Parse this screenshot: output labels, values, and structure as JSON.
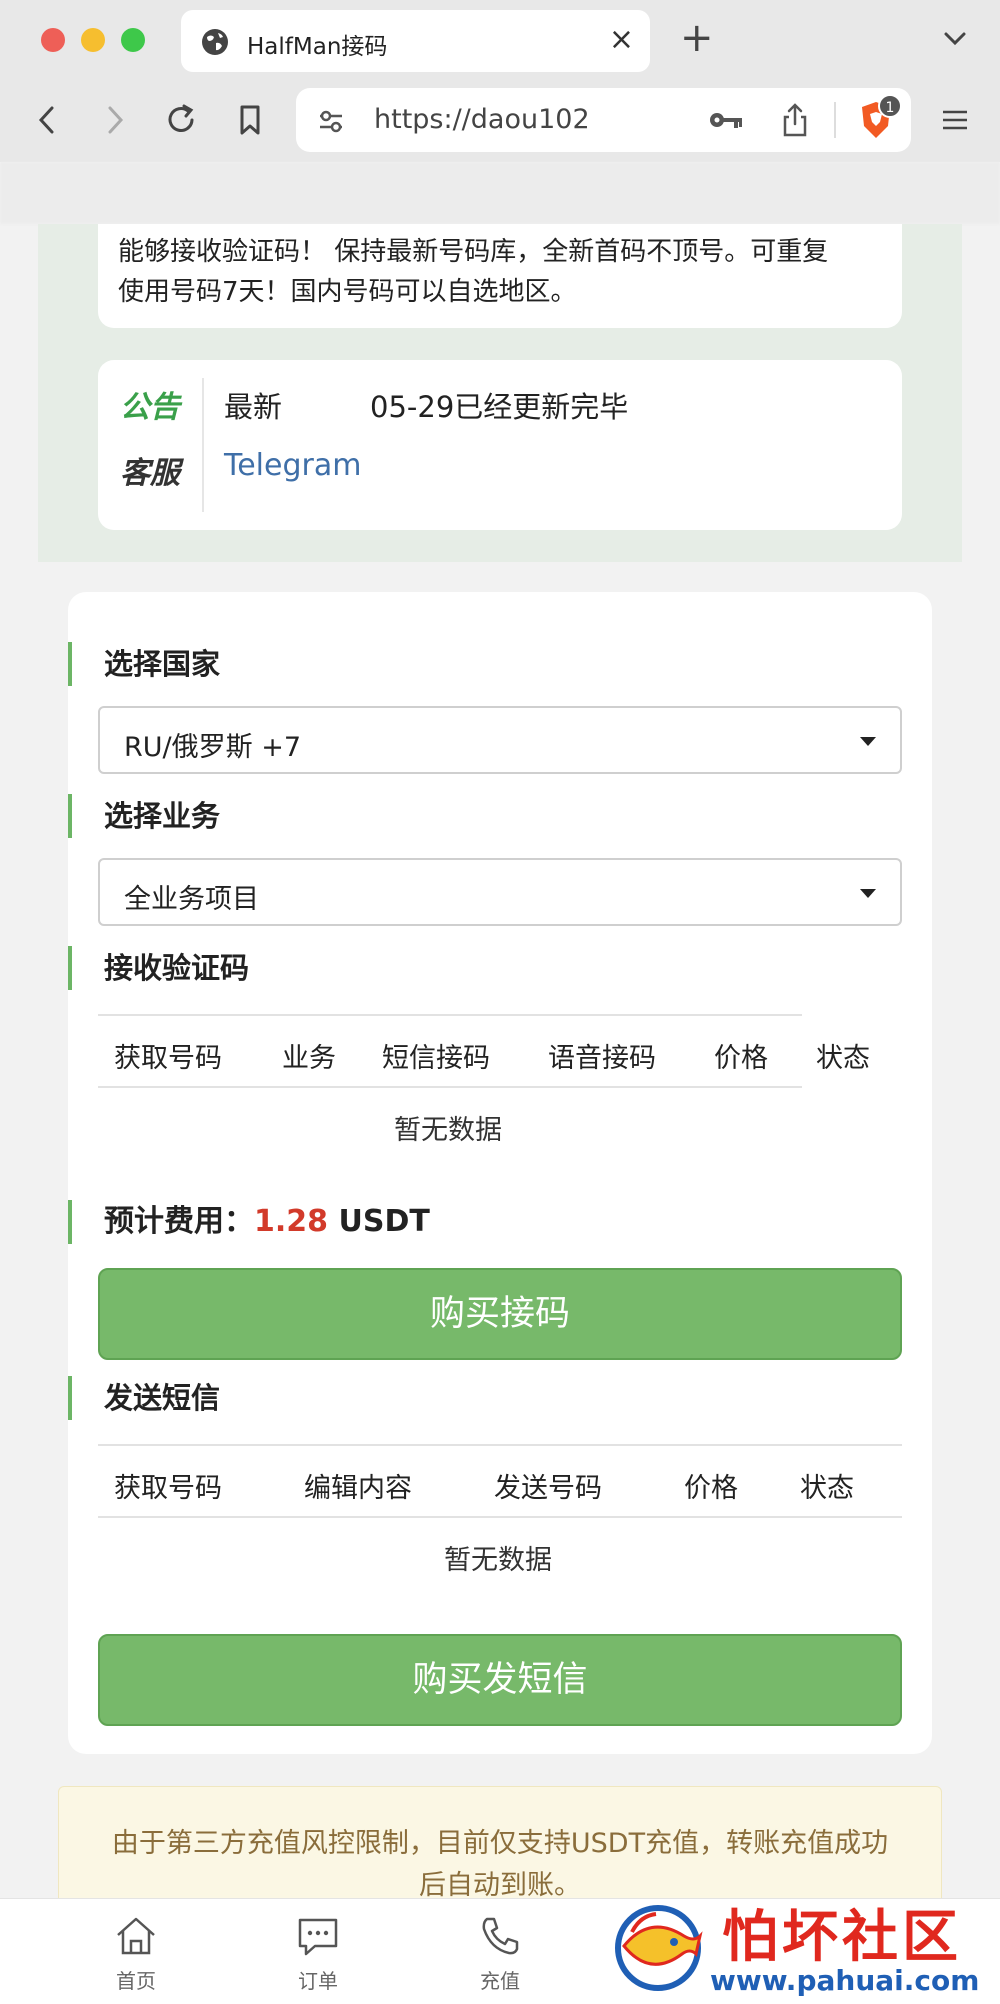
{
  "browser": {
    "tab_title": "HalfMan接码",
    "new_tab": "+",
    "tab_close": "×",
    "url": "https://daou102",
    "brave_badge": "1"
  },
  "intro": {
    "line1": "能够接收验证码！ 保持最新号码库，全新首码不顶号。可重复",
    "line2": "使用号码7天！国内号码可以自选地区。"
  },
  "notice": {
    "key1": "公告",
    "key2": "客服",
    "label": "最新",
    "text": "05-29已经更新完毕",
    "link": "Telegram"
  },
  "country": {
    "title": "选择国家",
    "value": "RU/俄罗斯 +7"
  },
  "service": {
    "title": "选择业务",
    "value": "全业务项目"
  },
  "receive": {
    "title": "接收验证码",
    "headers": [
      "获取号码",
      "业务",
      "短信接码",
      "语音接码",
      "价格",
      "状态"
    ],
    "empty": "暂无数据"
  },
  "cost": {
    "label": "预计费用：",
    "value": "1.28",
    "unit": " USDT"
  },
  "buy_receive_label": "购买接码",
  "send": {
    "title": "发送短信",
    "headers": [
      "获取号码",
      "编辑内容",
      "发送号码",
      "价格",
      "状态"
    ],
    "empty": "暂无数据"
  },
  "buy_send_label": "购买发短信",
  "warning": {
    "line1": "由于第三方充值风控限制，目前仅支持USDT充值，转账充值成功",
    "line2": "后自动到账。"
  },
  "tabnav": {
    "items": [
      {
        "label": "首页",
        "icon": "home-icon"
      },
      {
        "label": "订单",
        "icon": "chat-icon"
      },
      {
        "label": "充值",
        "icon": "phone-icon"
      }
    ]
  },
  "watermark": {
    "title": "怕坏社区",
    "url": "www.pahuai.com"
  },
  "colors": {
    "accent_green": "#77b96a",
    "price_red": "#d23a2a",
    "link_blue": "#3f6fa8"
  }
}
